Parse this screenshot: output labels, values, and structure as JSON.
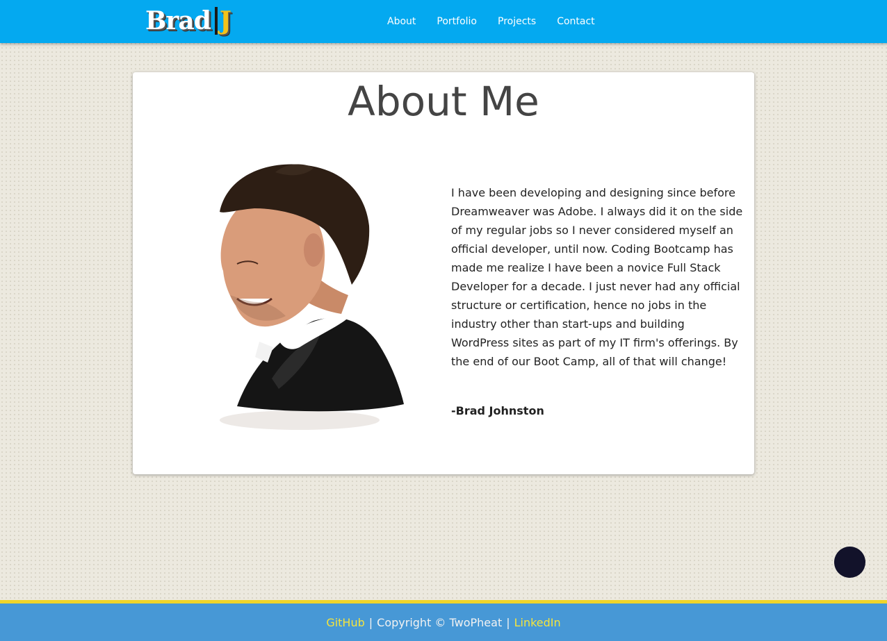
{
  "nav": {
    "brand_name": "Brad",
    "brand_initial": "J",
    "links": [
      "About",
      "Portfolio",
      "Projects",
      "Contact"
    ]
  },
  "card": {
    "title": "About Me",
    "bio": "I have been developing and designing since before Dreamweaver was Adobe. I always did it on the side of my regular jobs so I never considered myself an official developer, until now. Coding Bootcamp has made me realize I have been a novice Full Stack Developer for a decade. I just never had any official structure or certification, hence no jobs in the industry other than start-ups and building WordPress sites as part of my IT firm's offerings. By the end of our Boot Camp, all of that will change!",
    "signature": "-Brad Johnston"
  },
  "footer": {
    "github_label": "GitHub",
    "separator": "|",
    "copyright": "Copyright © TwoPheat",
    "linkedin_label": "LinkedIn"
  },
  "colors": {
    "navbar": "#04a9f0",
    "footer": "#4798d6",
    "footer_border": "#f0d52a",
    "footer_link": "#f5e43c",
    "brand_accent": "#f6c21a",
    "fab": "#12122a"
  }
}
